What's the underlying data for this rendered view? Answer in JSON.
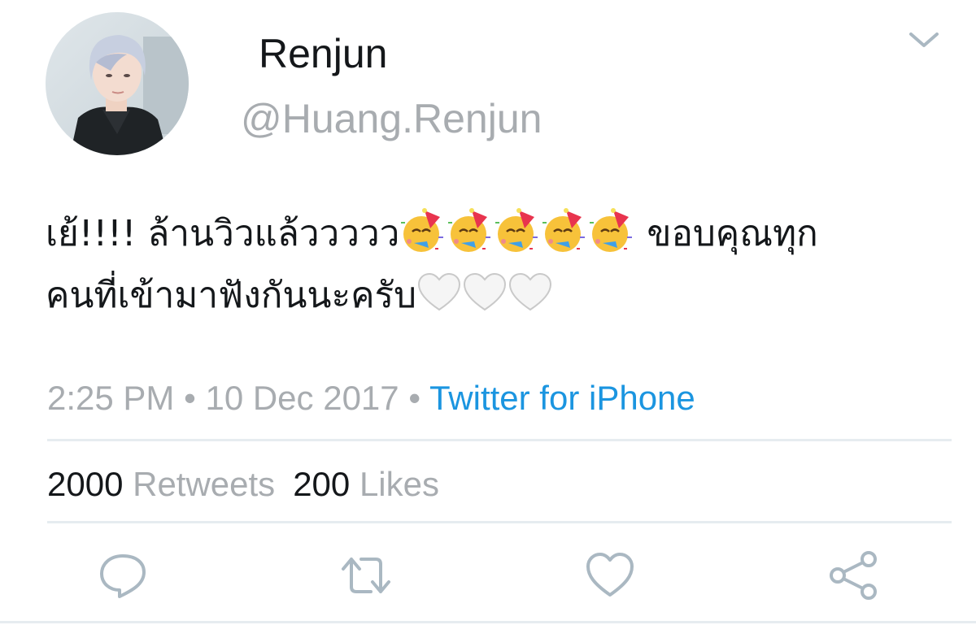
{
  "user": {
    "display_name": "Renjun",
    "handle": "@Huang.Renjun"
  },
  "tweet": {
    "text_line1_start": "เย้!!!! ล้านวิวแล้ววววว",
    "text_line1_end": " ขอบคุณทุก",
    "text_line2": "คนที่เข้ามาฟังกันนะครับ",
    "emojis_line1": [
      "party-face-emoji",
      "party-face-emoji",
      "party-face-emoji",
      "party-face-emoji",
      "party-face-emoji"
    ],
    "emojis_line2": [
      "white-heart-emoji",
      "white-heart-emoji",
      "white-heart-emoji"
    ]
  },
  "meta": {
    "time": "2:25 PM",
    "date": "10 Dec 2017",
    "separator": " • ",
    "source": "Twitter for iPhone"
  },
  "stats": {
    "retweets_count": "2000",
    "retweets_label": "Retweets",
    "likes_count": "200",
    "likes_label": "Likes"
  },
  "actions": [
    "reply-icon",
    "retweet-icon",
    "like-icon",
    "share-icon"
  ],
  "colors": {
    "text": "#14171a",
    "secondary": "#a8acb0",
    "link": "#1b95e0",
    "divider": "#e6ecf0",
    "icon": "#aab8c2"
  }
}
